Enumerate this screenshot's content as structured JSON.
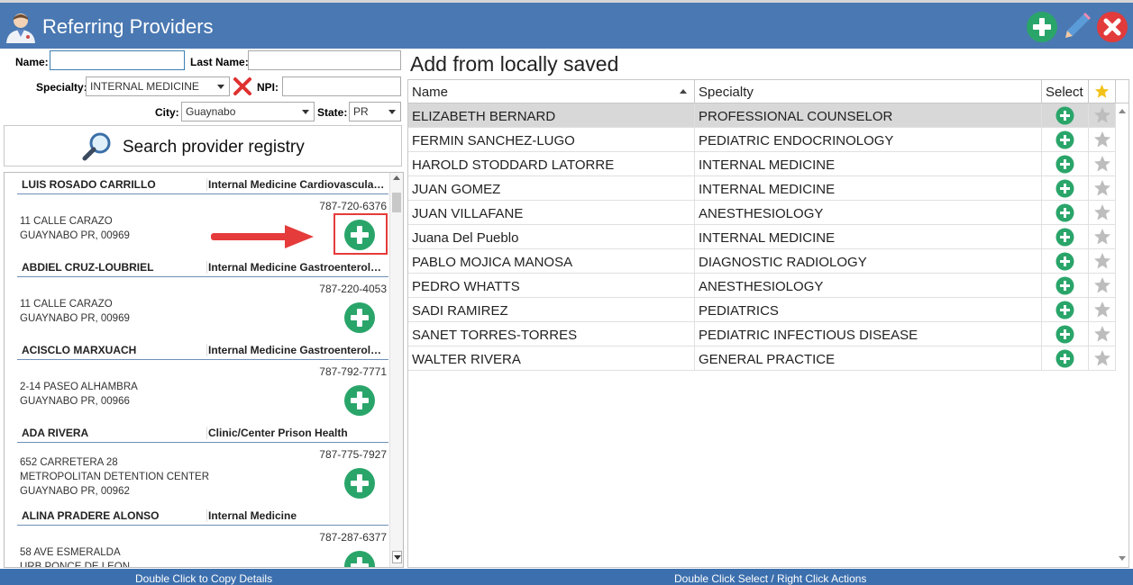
{
  "window": {
    "title": "Referring Providers",
    "icons": {
      "avatar": "doctor-avatar-icon",
      "add": "plus-circle-icon",
      "edit": "pencil-icon",
      "close": "close-x-icon"
    }
  },
  "search": {
    "name_label": "Name:",
    "name_value": "",
    "last_name_label": "Last Name:",
    "last_name_value": "",
    "specialty_label": "Specialty:",
    "specialty_value": "INTERNAL MEDICINE",
    "npi_label": "NPI:",
    "npi_value": "",
    "city_label": "City:",
    "city_value": "Guaynabo",
    "state_label": "State:",
    "state_value": "PR",
    "search_button_label": "Search provider registry"
  },
  "results": [
    {
      "name": "LUIS ROSADO CARRILLO",
      "specialty": "Internal Medicine Cardiovascular Disease",
      "phone": "787-720-6376",
      "address": [
        "11 CALLE CARAZO",
        "GUAYNABO PR, 00969"
      ],
      "highlighted": true
    },
    {
      "name": "ABDIEL CRUZ-LOUBRIEL",
      "specialty": "Internal Medicine Gastroenterology",
      "phone": "787-220-4053",
      "address": [
        "11 CALLE CARAZO",
        "GUAYNABO PR, 00969"
      ]
    },
    {
      "name": "ACISCLO MARXUACH",
      "specialty": "Internal Medicine Gastroenterology",
      "phone": "787-792-7771",
      "address": [
        "2-14 PASEO ALHAMBRA",
        "GUAYNABO PR, 00966"
      ]
    },
    {
      "name": "ADA RIVERA",
      "specialty": "Clinic/Center Prison Health",
      "phone": "787-775-7927",
      "address": [
        "652 CARRETERA 28",
        "METROPOLITAN DETENTION CENTER",
        "GUAYNABO PR, 00962"
      ]
    },
    {
      "name": "ALINA PRADERE ALONSO",
      "specialty": "Internal Medicine",
      "phone": "787-287-6377",
      "address": [
        "58 AVE ESMERALDA",
        "URB PONCE DE LEON"
      ]
    }
  ],
  "saved": {
    "title": "Add from locally saved",
    "columns": {
      "name": "Name",
      "specialty": "Specialty",
      "select": "Select"
    },
    "rows": [
      {
        "name": "ELIZABETH BERNARD",
        "specialty": "PROFESSIONAL COUNSELOR",
        "selected": true
      },
      {
        "name": "FERMIN SANCHEZ-LUGO",
        "specialty": "PEDIATRIC ENDOCRINOLOGY"
      },
      {
        "name": "HAROLD STODDARD LATORRE",
        "specialty": "INTERNAL MEDICINE"
      },
      {
        "name": "JUAN GOMEZ",
        "specialty": "INTERNAL MEDICINE"
      },
      {
        "name": "JUAN VILLAFANE",
        "specialty": "ANESTHESIOLOGY"
      },
      {
        "name": "Juana  Del Pueblo",
        "specialty": "INTERNAL MEDICINE"
      },
      {
        "name": "PABLO MOJICA MANOSA",
        "specialty": "DIAGNOSTIC RADIOLOGY"
      },
      {
        "name": "PEDRO WHATTS",
        "specialty": "ANESTHESIOLOGY"
      },
      {
        "name": "SADI RAMIREZ",
        "specialty": "PEDIATRICS"
      },
      {
        "name": "SANET TORRES-TORRES",
        "specialty": "PEDIATRIC INFECTIOUS DISEASE"
      },
      {
        "name": "WALTER RIVERA",
        "specialty": "GENERAL PRACTICE"
      }
    ]
  },
  "status": {
    "left": "Double Click to Copy Details",
    "right": "Double Click Select / Right Click Actions"
  },
  "colors": {
    "titlebar": "#4a78b2",
    "statusbar": "#3c6fad",
    "add_green": "#2aa56a",
    "highlight_red": "#e53b3b",
    "star_gold": "#f2c21b"
  }
}
